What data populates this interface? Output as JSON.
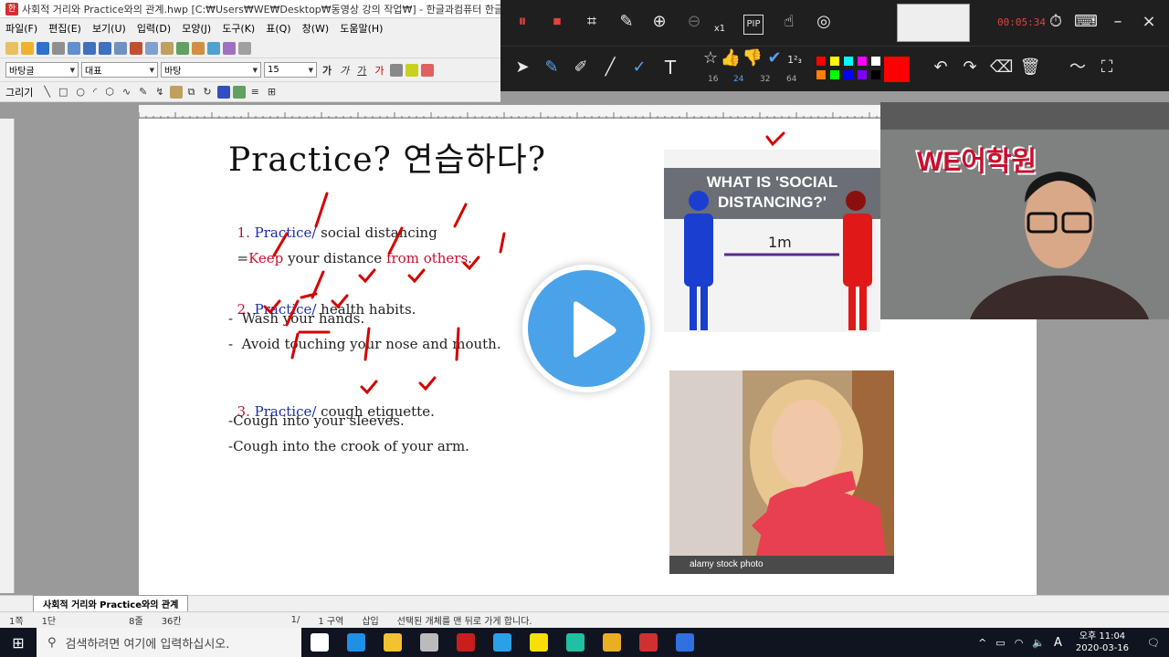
{
  "window": {
    "title": "사회적 거리와 Practice와의 관계.hwp [C:₩Users₩WE₩Desktop₩동영상 강의 작업₩] - 한글과컴퓨터 한글"
  },
  "menubar": {
    "items": [
      "파일(F)",
      "편집(E)",
      "보기(U)",
      "입력(D)",
      "모양(J)",
      "도구(K)",
      "표(Q)",
      "창(W)",
      "도움말(H)"
    ]
  },
  "format_toolbar": {
    "style": "바탕글",
    "font_lang": "대표",
    "font_name": "바탕",
    "font_size": "15"
  },
  "draw_toolbar": {
    "label": "그리기"
  },
  "annotation_toolbar": {
    "zoom_label": "x1",
    "pip_label": "PIP",
    "timer": "00:05:34",
    "stroke_sizes": [
      "16",
      "24",
      "32",
      "64"
    ],
    "selected_stroke": "24",
    "palette": [
      "#ff0000",
      "#ffff00",
      "#00ffff",
      "#ff00ff",
      "#ffffff",
      "#ff8000",
      "#00ff00",
      "#0000ff",
      "#8000ff",
      "#000000",
      "#ff0000"
    ]
  },
  "document": {
    "title": "Practice?  연습하다?",
    "lines": [
      {
        "num": "1.",
        "head": "Practice/",
        "rest": " social distancing"
      },
      {
        "prefix": "=",
        "keep": "Keep",
        "mid": " your distance ",
        "from": "from others",
        "end": "."
      },
      {
        "num": "2.",
        "head": "Practice/",
        "rest": " health habits."
      },
      {
        "text": "-  Wash your hands."
      },
      {
        "text": "-  Avoid touching your nose and mouth."
      },
      {
        "num": "3.",
        "head": "Practice/",
        "rest": " cough etiquette."
      },
      {
        "text": "-Cough into your sleeves."
      },
      {
        "text": "-Cough into the crook of your arm."
      }
    ],
    "image1": {
      "banner": "WHAT IS 'SOCIAL DISTANCING?'",
      "distance": "1m"
    },
    "image2": {
      "caption": "alamy stock photo"
    }
  },
  "webcam": {
    "sign": "WE어학원"
  },
  "sheet_tab": "사회적 거리와 Practice와의 관계",
  "statusbar": {
    "page": "1쪽",
    "column": "1단",
    "line": "8줄",
    "col": "36칸",
    "section_pages": "1/",
    "section": "1 구역",
    "mode": "삽입",
    "message": "선택된 개체를 맨 뒤로 가게 합니다."
  },
  "taskbar": {
    "search_placeholder": "검색하려면 여기에 입력하십시오.",
    "time": "오후 11:04",
    "date": "2020-03-16",
    "ime": "A",
    "apps": [
      {
        "name": "task-view",
        "color": "#ffffff"
      },
      {
        "name": "edge",
        "color": "#1e90e8"
      },
      {
        "name": "file-explorer",
        "color": "#f2c230"
      },
      {
        "name": "settings",
        "color": "#bbbbbb"
      },
      {
        "name": "app-red",
        "color": "#c81e1e"
      },
      {
        "name": "ie",
        "color": "#2aa0e8"
      },
      {
        "name": "kakaotalk",
        "color": "#f8e000"
      },
      {
        "name": "app-teal",
        "color": "#20c0a0"
      },
      {
        "name": "chrome",
        "color": "#e8b020"
      },
      {
        "name": "hwp",
        "color": "#d03030"
      },
      {
        "name": "recorder",
        "color": "#3070e0"
      }
    ]
  }
}
